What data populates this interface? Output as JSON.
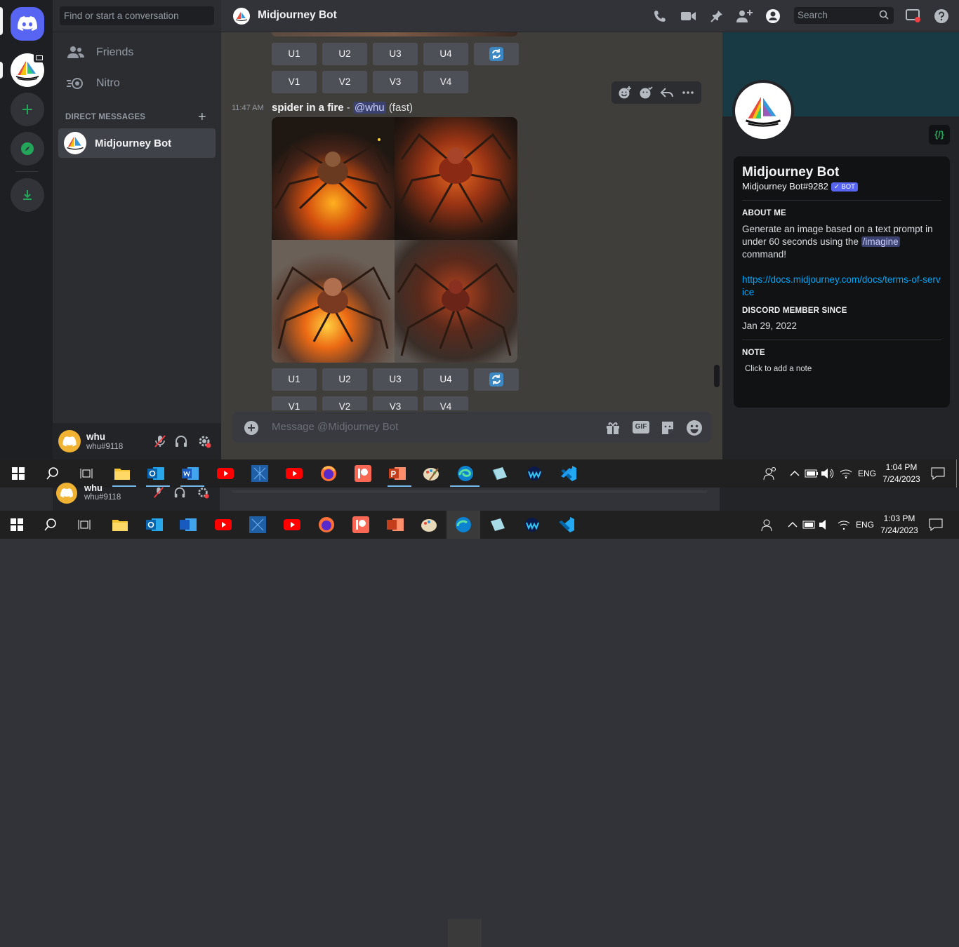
{
  "sidebar": {
    "search_placeholder": "Find or start a conversation",
    "nav": [
      {
        "label": "Friends",
        "icon": "friends-icon"
      },
      {
        "label": "Nitro",
        "icon": "nitro-icon"
      }
    ],
    "section_header": "DIRECT MESSAGES",
    "active_dm": "Midjourney Bot"
  },
  "user": {
    "name": "whu",
    "tag": "whu#9118"
  },
  "header": {
    "title": "Midjourney Bot",
    "search_placeholder": "Search"
  },
  "message": {
    "time": "11:47 AM",
    "prompt": "spider in a fire",
    "separator": " - ",
    "mention": "@whu",
    "mode": "(fast)",
    "buttons_top": [
      "U1",
      "U2",
      "U3",
      "U4"
    ],
    "buttons_bottom": [
      "V1",
      "V2",
      "V3",
      "V4"
    ]
  },
  "input": {
    "placeholder": "Message @Midjourney Bot",
    "gif_label": "GIF"
  },
  "profile": {
    "name": "Midjourney Bot",
    "tag": "Midjourney Bot#9282",
    "bot_badge": "✓ BOT",
    "dev_badge": "{/}",
    "about_header": "ABOUT ME",
    "about_text_1": "Generate an image based on a text prompt in under 60 seconds using the ",
    "about_cmd": "/imagine",
    "about_text_2": " command!",
    "link": "https://docs.midjourney.com/docs/terms-of-service",
    "member_header": "DISCORD MEMBER SINCE",
    "member_since": "Jan 29, 2022",
    "note_header": "NOTE",
    "note_placeholder": "Click to add a note"
  },
  "taskbar_front": {
    "time": "1:04 PM",
    "date": "7/24/2023",
    "lang": "ENG"
  },
  "taskbar_back": {
    "time": "1:03 PM",
    "date": "7/24/2023",
    "lang": "ENG"
  },
  "colors": {
    "blurple": "#5865f2",
    "green": "#23a55a",
    "link": "#00a8fc",
    "mention_bg": "#3c4270"
  }
}
